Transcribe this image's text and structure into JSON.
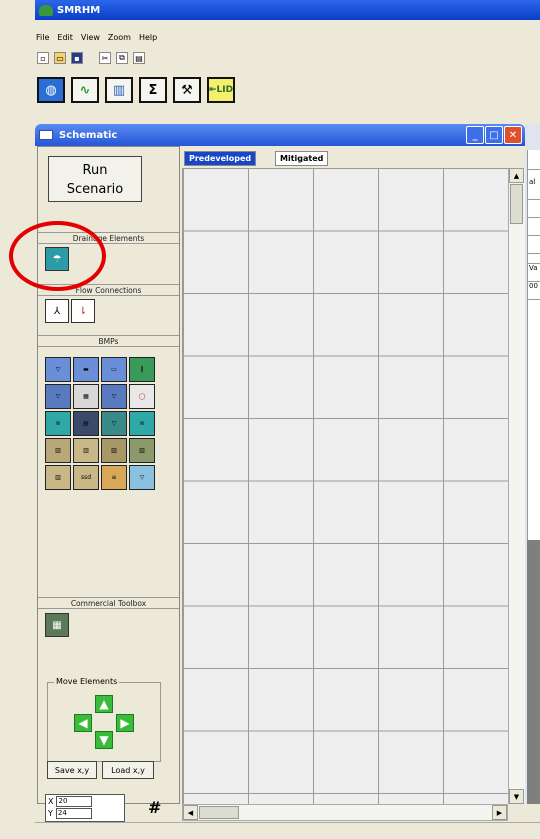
{
  "app": {
    "title": "SMRHM"
  },
  "menu": [
    "File",
    "Edit",
    "View",
    "Zoom",
    "Help"
  ],
  "schematic": {
    "title": "Schematic",
    "run_label_line1": "Run",
    "run_label_line2": "Scenario",
    "sections": {
      "drainage": "Drainage Elements",
      "flow": "Flow Connections",
      "bmps": "BMPs",
      "commercial": "Commercial Toolbox"
    },
    "move_elements": "Move Elements",
    "save_xy": "Save x,y",
    "load_xy": "Load x,y",
    "coord_x_label": "X",
    "coord_x_value": "20",
    "coord_y_label": "Y",
    "coord_y_value": "24",
    "grid_toggle": "#"
  },
  "tabs": {
    "predeveloped": "Predeveloped",
    "mitigated": "Mitigated"
  },
  "right_panel": {
    "cells": [
      "",
      "al",
      "",
      "",
      "",
      "",
      "Va",
      "00"
    ]
  },
  "colors": {
    "title_bar": "#0a3ec8",
    "active_tab": "#1747c6",
    "highlight_circle": "#e40000"
  }
}
